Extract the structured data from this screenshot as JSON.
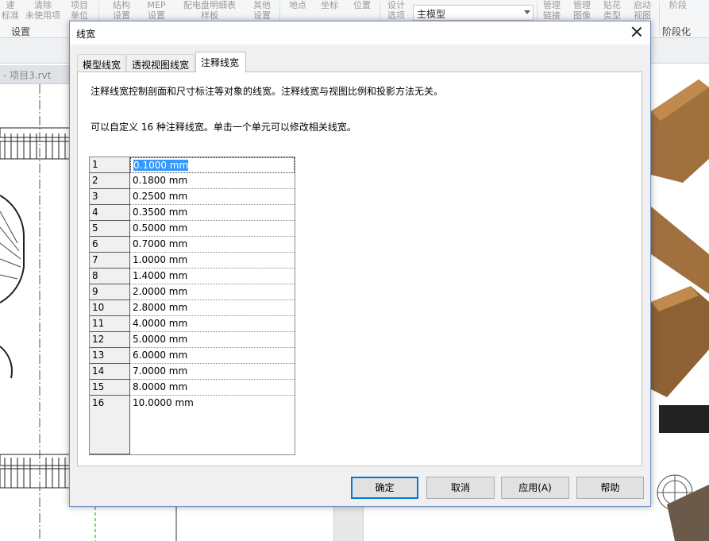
{
  "ribbon": {
    "items": [
      "速\n标准",
      "清除\n未使用项",
      "项目\n单位",
      "结构\n设置",
      "MEP\n设置",
      "配电盘明细表\n样板",
      "其他\n设置",
      "地点",
      "坐标",
      "位置",
      "设计\n选项",
      "管理\n链接",
      "管理\n图像",
      "贴花\n类型",
      "启动\n视图",
      "阶段"
    ],
    "groups": [
      "设置",
      "阶段化"
    ],
    "combo_value": "主模型"
  },
  "view_tab": "- 项目3.rvt",
  "dialog": {
    "title": "线宽",
    "tabs": [
      "模型线宽",
      "透视视图线宽",
      "注释线宽"
    ],
    "active_tab_index": 2,
    "description1": "注释线宽控制剖面和尺寸标注等对象的线宽。注释线宽与视图比例和投影方法无关。",
    "description2": "可以自定义 16 种注释线宽。单击一个单元可以修改相关线宽。",
    "rows": [
      {
        "index": "1",
        "value": "0.1000 mm"
      },
      {
        "index": "2",
        "value": "0.1800 mm"
      },
      {
        "index": "3",
        "value": "0.2500 mm"
      },
      {
        "index": "4",
        "value": "0.3500 mm"
      },
      {
        "index": "5",
        "value": "0.5000 mm"
      },
      {
        "index": "6",
        "value": "0.7000 mm"
      },
      {
        "index": "7",
        "value": "1.0000 mm"
      },
      {
        "index": "8",
        "value": "1.4000 mm"
      },
      {
        "index": "9",
        "value": "2.0000 mm"
      },
      {
        "index": "10",
        "value": "2.8000 mm"
      },
      {
        "index": "11",
        "value": "4.0000 mm"
      },
      {
        "index": "12",
        "value": "5.0000 mm"
      },
      {
        "index": "13",
        "value": "6.0000 mm"
      },
      {
        "index": "14",
        "value": "7.0000 mm"
      },
      {
        "index": "15",
        "value": "8.0000 mm"
      },
      {
        "index": "16",
        "value": "10.0000 mm"
      }
    ],
    "buttons": {
      "ok": "确定",
      "cancel": "取消",
      "apply": "应用(A)",
      "help": "帮助"
    }
  },
  "colors": {
    "accent": "#0078d7",
    "selection": "#3399ff",
    "wood": "#a0703f"
  }
}
